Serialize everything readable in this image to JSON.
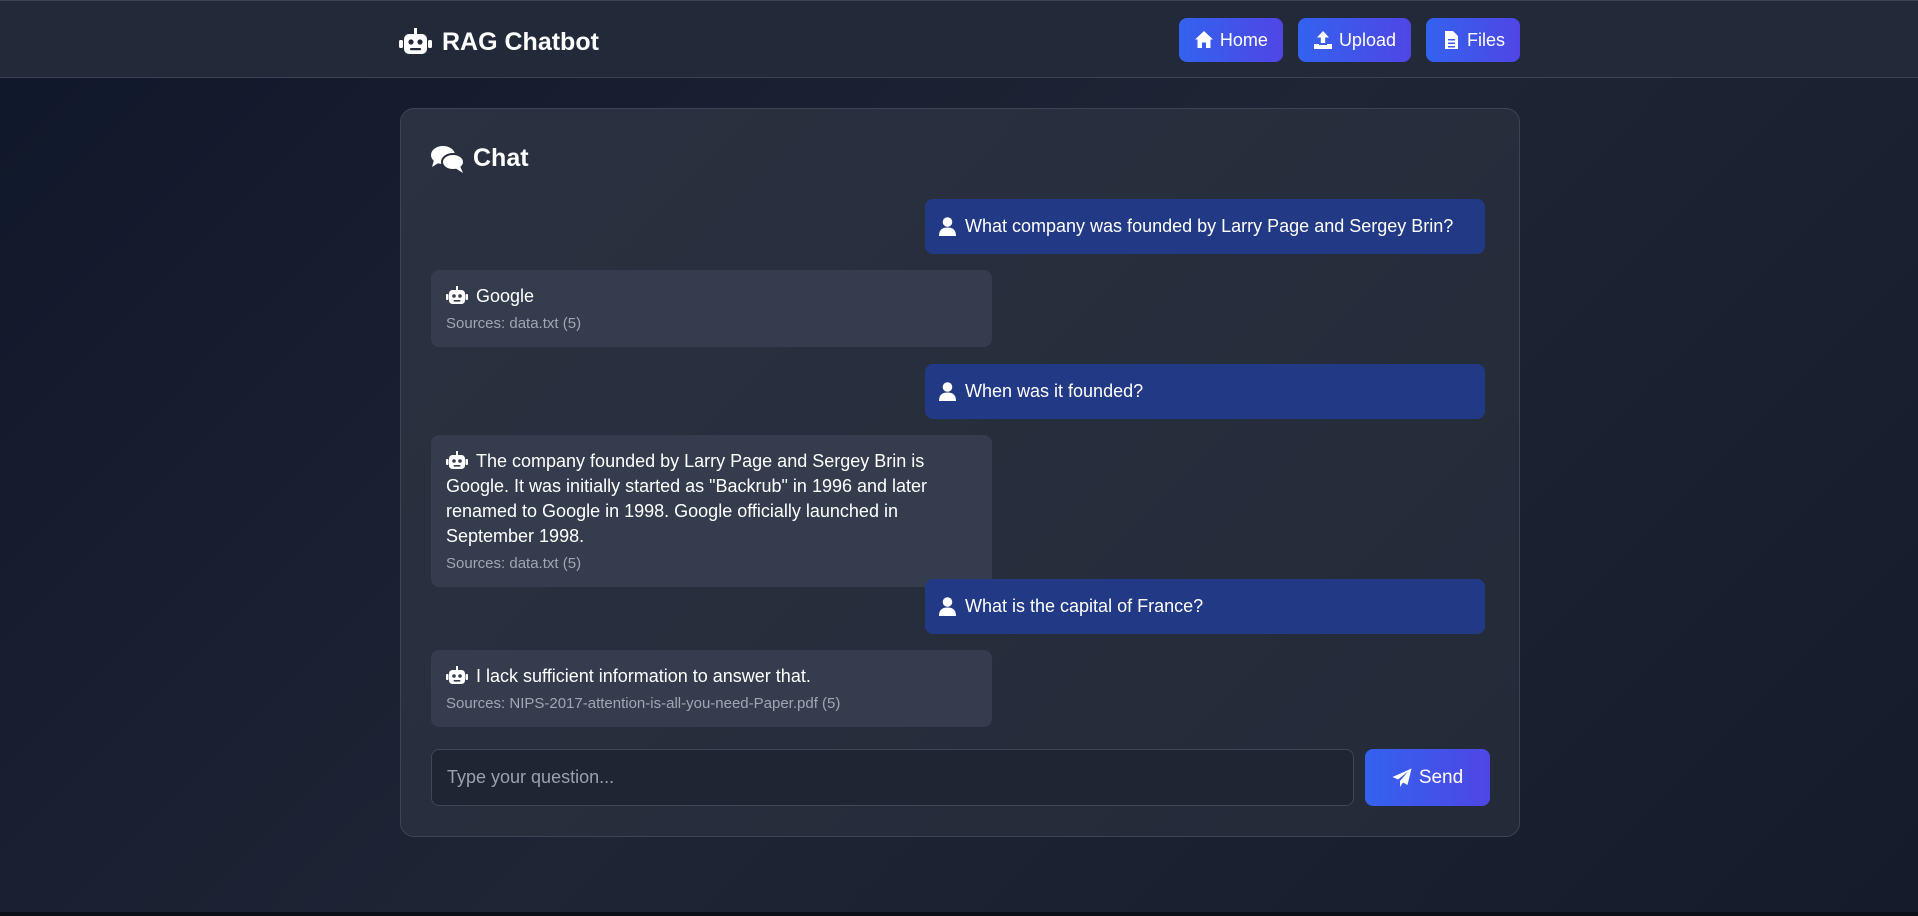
{
  "header": {
    "brand_icon": "robot-icon",
    "title": "RAG Chatbot",
    "nav": [
      {
        "label": "Home",
        "icon": "home-icon"
      },
      {
        "label": "Upload",
        "icon": "upload-icon"
      },
      {
        "label": "Files",
        "icon": "file-icon"
      }
    ]
  },
  "chat": {
    "title": "Chat",
    "title_icon": "comments-icon",
    "messages": [
      {
        "role": "user",
        "text": "What company was founded by Larry Page and Sergey Brin?"
      },
      {
        "role": "bot",
        "text": "Google",
        "sources": "Sources: data.txt (5)"
      },
      {
        "role": "user",
        "text": "When was it founded?"
      },
      {
        "role": "bot",
        "text": "The company founded by Larry Page and Sergey Brin is Google. It was initially started as \"Backrub\" in 1996 and later renamed to Google in 1998. Google officially launched in September 1998.",
        "sources": "Sources: data.txt (5)"
      },
      {
        "role": "user",
        "text": "What is the capital of France?"
      },
      {
        "role": "bot",
        "text": "I lack sufficient information to answer that.",
        "sources": "Sources: NIPS-2017-attention-is-all-you-need-Paper.pdf (5)"
      }
    ],
    "input": {
      "value": "",
      "placeholder": "Type your question..."
    },
    "send_label": "Send",
    "send_icon": "paper-plane-icon"
  },
  "colors": {
    "accent": "#3362ee",
    "accent_end": "#4f46e5",
    "user_bubble": "#223a85",
    "bot_bubble": "#343c4d"
  }
}
